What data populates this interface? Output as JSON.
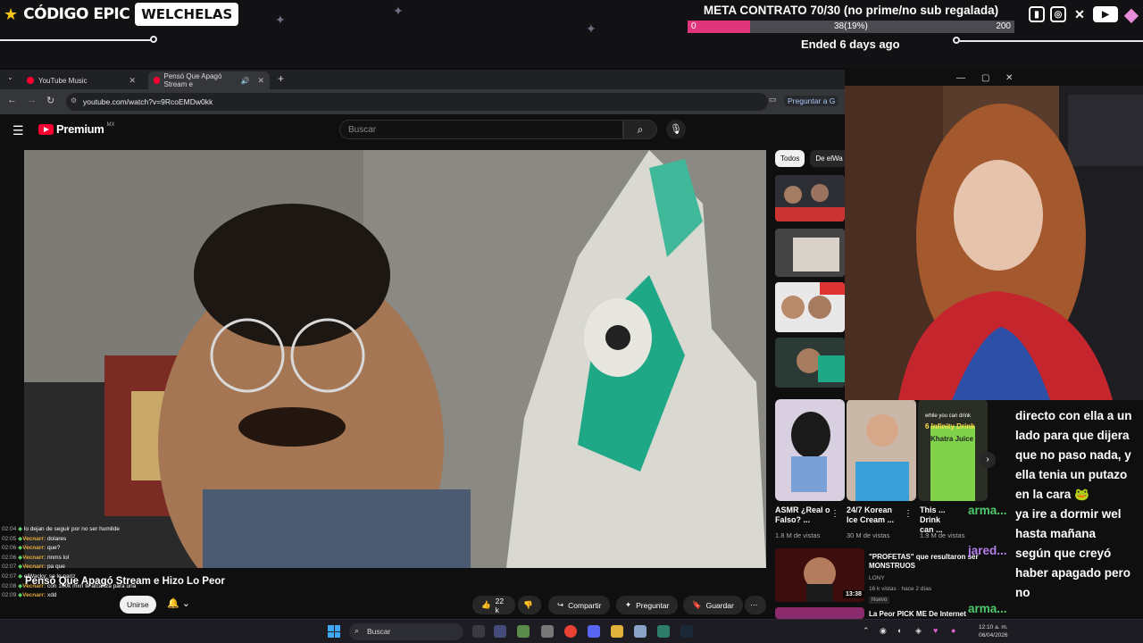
{
  "overlay": {
    "brand": "CÓDIGO EPIC",
    "tag": "WELCHELAS",
    "goal_title": "META CONTRATO 70/30 (no prime/no sub regalada)",
    "goal_min": "0",
    "goal_current": "38(19%)",
    "goal_max": "200",
    "goal_progress": 0.19,
    "goal_status": "Ended 6 days ago",
    "socials": [
      "twitch-icon",
      "instagram-icon",
      "twitter-icon",
      "youtube-icon",
      "gem-icon"
    ],
    "accent": "#e0357a"
  },
  "browser": {
    "tabs": [
      {
        "label": "YouTube Music"
      },
      {
        "label": "Pensó Que Apagó Stream e"
      }
    ],
    "url": "youtube.com/watch?v=9RcoEMDw0kk",
    "ask_label": "Preguntar a G"
  },
  "youtube": {
    "logo": "Premium",
    "region": "MX",
    "search_placeholder": "Buscar",
    "video_title": "Pensó Que Apagó Stream e Hizo Lo Peor",
    "join_label": "Unirse",
    "likes": "22 k",
    "share_label": "Compartir",
    "ask_label": "Preguntar",
    "save_label": "Guardar",
    "chips": [
      "Todos",
      "De elWa"
    ],
    "shorts": [
      {
        "title": "ASMR ¿Real o Falso? ...",
        "views": "1.8 M de vistas"
      },
      {
        "title": "24/7 Korean Ice Cream ...",
        "views": "30 M de vistas"
      },
      {
        "title": "This ... Drink can ...",
        "views": "1.9 M de vistas"
      }
    ],
    "shorts_overlay_text": [
      "while you can drink",
      "6 Infinity Drink",
      "Khatra Juice"
    ],
    "recs": [
      {
        "title": "\"PROFETAS\" que resultaron ser MONSTRUOS",
        "channel": "LONY",
        "meta": "16 k vistas · hace 2 días",
        "badge": "Nuevo",
        "duration": "13:38"
      },
      {
        "title": "La Peor PICK ME De Internet"
      }
    ]
  },
  "chat_overlay": {
    "lines": [
      "directo con ella a un",
      "lado para que dijera",
      "que no paso nada, y",
      "ella tenia un putazo",
      "en la cara 🐸",
      "ya ire a dormir wel",
      "hasta mañana",
      "según que creyó",
      "haber apagado pero",
      "no"
    ],
    "names": [
      "arma...",
      "jared...",
      "arma..."
    ]
  },
  "mini_chat": [
    {
      "time": "02:04",
      "user": "",
      "text": "lo dejan de seguir por no ser humilde"
    },
    {
      "time": "02:05",
      "user": "Vecnarr:",
      "text": "dolares"
    },
    {
      "time": "02:06",
      "user": "Vecnarr:",
      "text": "que?"
    },
    {
      "time": "02:06",
      "user": "Vecnarr:",
      "text": "nnms lol"
    },
    {
      "time": "02:07",
      "user": "Vecnarr:",
      "text": "pa que"
    },
    {
      "time": "02:07",
      "user": "",
      "text": "elWacky: se le nariz"
    },
    {
      "time": "02:08",
      "user": "Vecnarr:",
      "text": "con 100k mxn te alcanza para una"
    },
    {
      "time": "02:09",
      "user": "Vecnarr:",
      "text": "xdd"
    }
  ],
  "taskbar": {
    "search_label": "Buscar",
    "time": "12:10 a. m.",
    "date": "06/04/2026"
  }
}
